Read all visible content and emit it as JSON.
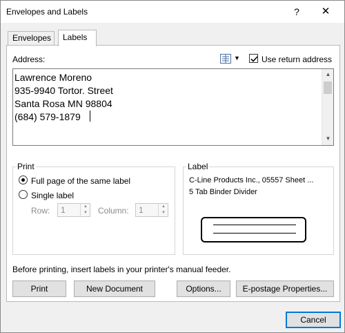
{
  "window": {
    "title": "Envelopes and Labels",
    "help": "?",
    "close": "✕"
  },
  "tabs": [
    {
      "label": "Envelopes",
      "active": false
    },
    {
      "label": "Labels",
      "active": true
    }
  ],
  "address": {
    "label": "Address:",
    "text": "Lawrence Moreno\n935-9940 Tortor. Street\nSanta Rosa MN 98804\n(684) 579-1879",
    "use_return_address": {
      "label": "Use return address",
      "checked": true
    },
    "address_book_icon": "address-book-icon"
  },
  "print_group": {
    "title": "Print",
    "options": [
      {
        "label": "Full page of the same label",
        "selected": true
      },
      {
        "label": "Single label",
        "selected": false
      }
    ],
    "row": {
      "label": "Row:",
      "value": "1"
    },
    "column": {
      "label": "Column:",
      "value": "1"
    }
  },
  "label_group": {
    "title": "Label",
    "product": "C-Line Products Inc., 05557 Sheet ...",
    "description": "5 Tab Binder Divider"
  },
  "feeder_note": "Before printing, insert labels in your printer's manual feeder.",
  "buttons": {
    "print": "Print",
    "new_document": "New Document",
    "options": "Options...",
    "epostage": "E-postage Properties...",
    "cancel": "Cancel"
  }
}
